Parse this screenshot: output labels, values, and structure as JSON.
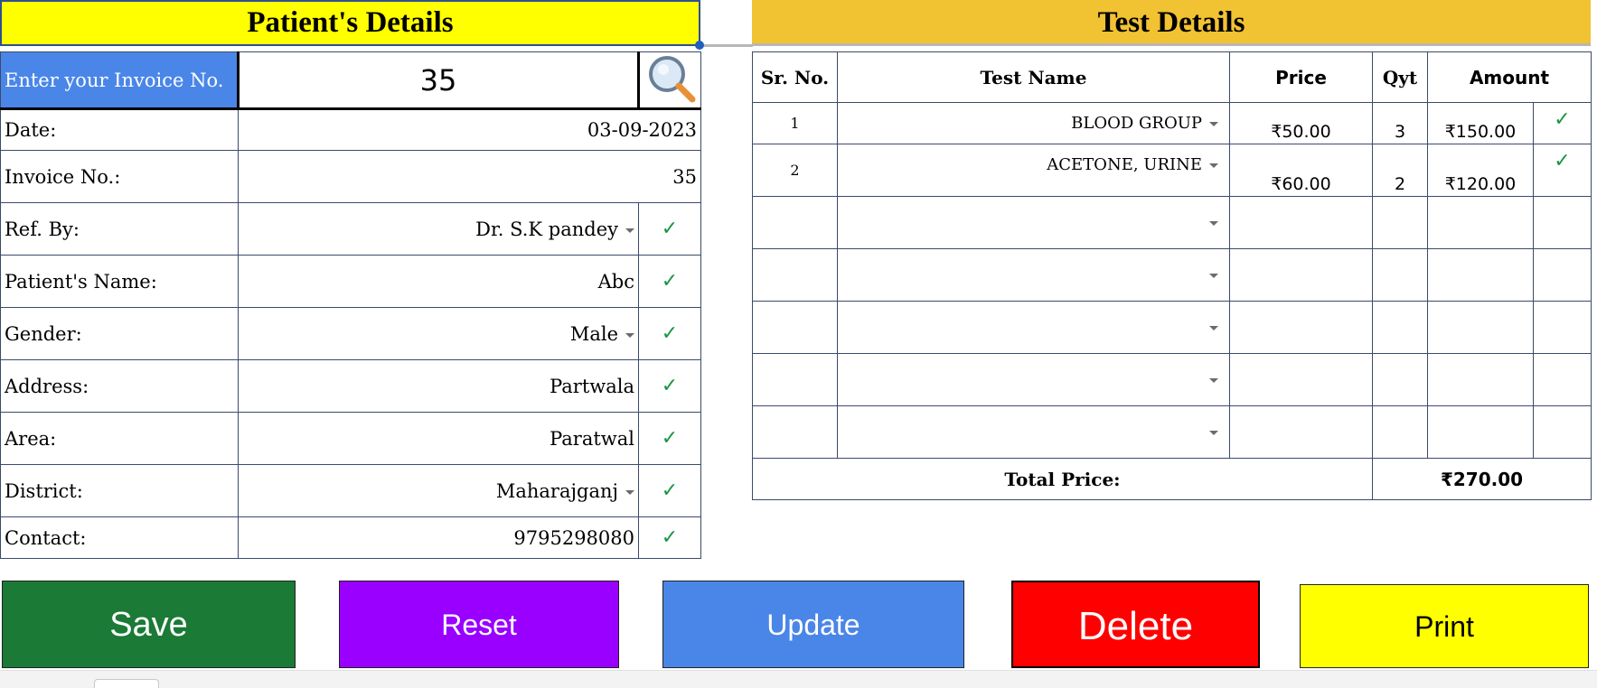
{
  "patient": {
    "title": "Patient's Details",
    "invoice_prompt": "Enter your Invoice No.",
    "invoice_input": "35",
    "fields": [
      {
        "label": "Date:",
        "value": "03-09-2023"
      },
      {
        "label": "Invoice No.:",
        "value": "35"
      },
      {
        "label": "Ref. By:",
        "value": "Dr. S.K pandey",
        "check": "✓"
      },
      {
        "label": "Patient's Name:",
        "value": "Abc",
        "check": "✓"
      },
      {
        "label": "Gender:",
        "value": "Male",
        "check": "✓"
      },
      {
        "label": "Address:",
        "value": "Partwala",
        "check": "✓"
      },
      {
        "label": "Area:",
        "value": "Paratwal",
        "check": "✓"
      },
      {
        "label": "District:",
        "value": "Maharajganj",
        "check": "✓"
      },
      {
        "label": "Contact:",
        "value": "9795298080",
        "check": "✓"
      }
    ]
  },
  "tests": {
    "title": "Test Details",
    "headers": {
      "sr": "Sr. No.",
      "name": "Test Name",
      "price": "Price",
      "qty": "Qyt",
      "amount": "Amount"
    },
    "rows": [
      {
        "sr": "1",
        "name": "BLOOD GROUP",
        "price": "₹50.00",
        "qty": "3",
        "amount": "₹150.00",
        "check": "✓"
      },
      {
        "sr": "2",
        "name": "ACETONE, URINE",
        "price": "₹60.00",
        "qty": "2",
        "amount": "₹120.00",
        "check": "✓"
      }
    ],
    "total_label": "Total Price:",
    "total_value": "₹270.00"
  },
  "buttons": {
    "save": "Save",
    "reset": "Reset",
    "update": "Update",
    "delete": "Delete",
    "print": "Print"
  },
  "icons": {
    "search": "magnifier-icon",
    "check": "check-icon",
    "dropdown": "dropdown-arrow-icon"
  },
  "colors": {
    "patient_header": "#ffff00",
    "test_header": "#f1c232",
    "invoice_label_bg": "#4a86e8",
    "check": "#1a9641",
    "save": "#1a7a36",
    "reset": "#9900ff",
    "update": "#4a86e8",
    "delete": "#ff0000",
    "print": "#ffff00"
  }
}
